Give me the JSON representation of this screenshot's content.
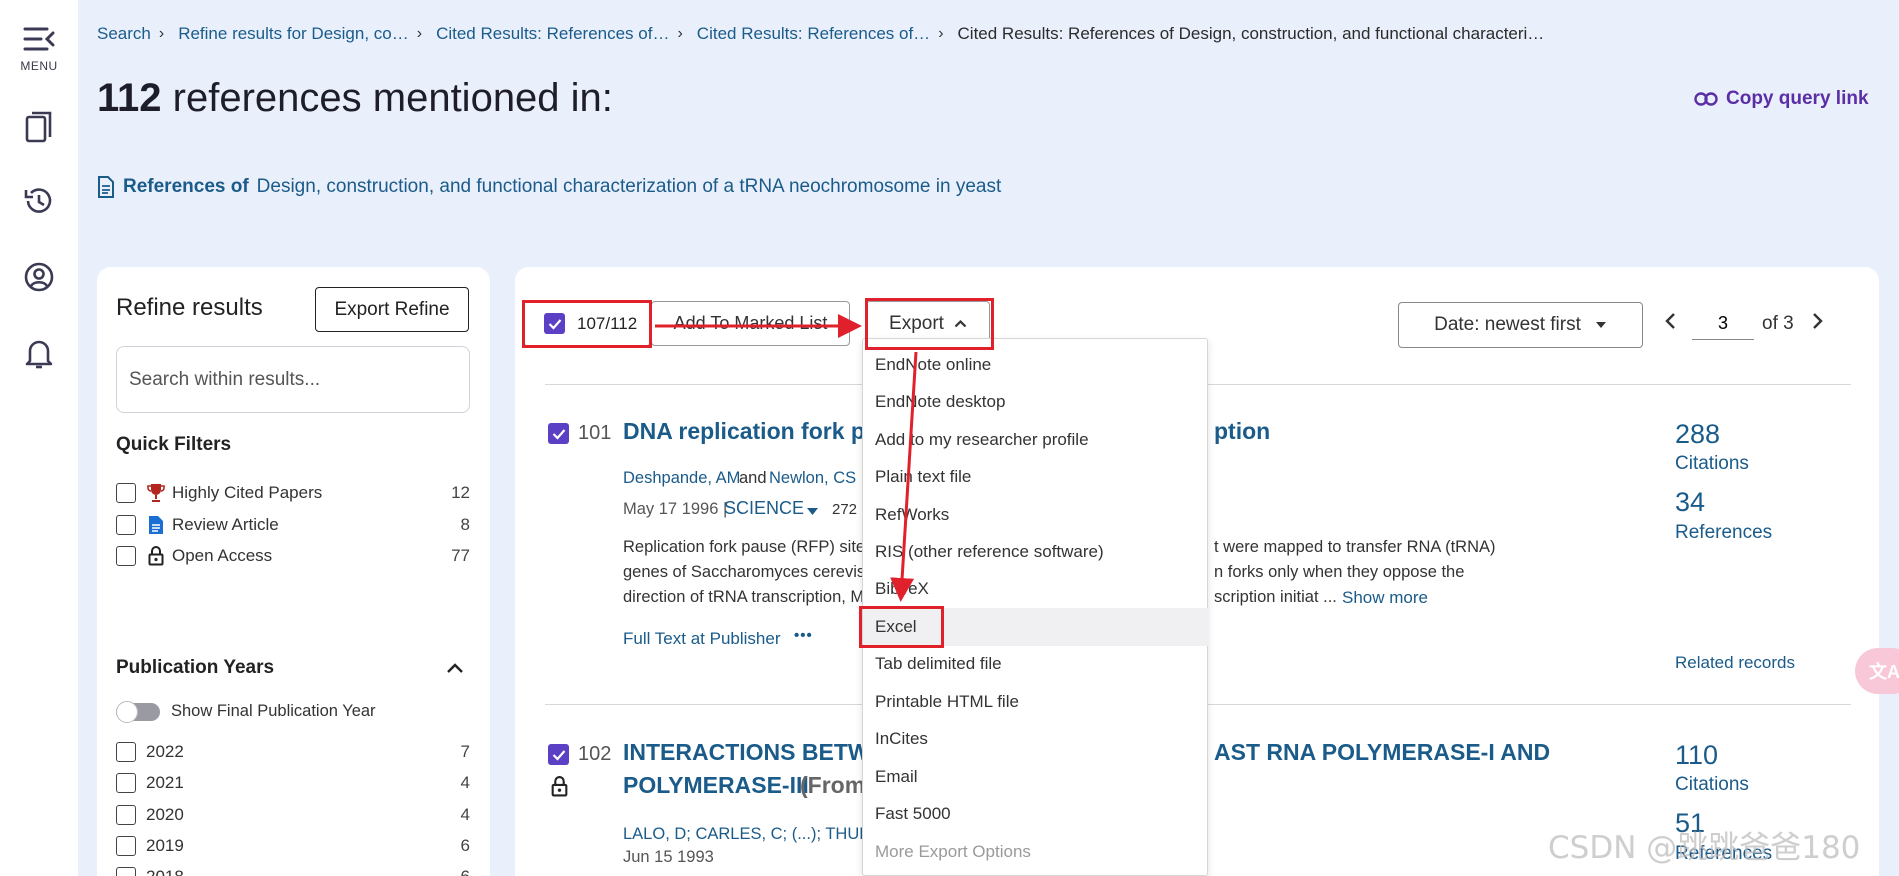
{
  "nav": {
    "menu_label": "MENU"
  },
  "breadcrumb": {
    "items": [
      "Search",
      "Refine results for Design, co…",
      "Cited Results: References of…",
      "Cited Results: References of…"
    ],
    "current": "Cited Results: References of Design, construction, and functional characteri…"
  },
  "header": {
    "count": "112",
    "title_rest": "references mentioned in:",
    "copy_link": "Copy query link",
    "refs_of_label": "References of",
    "refs_of_title": "Design, construction, and functional characterization of a tRNA neochromosome in yeast"
  },
  "refine": {
    "title": "Refine results",
    "export_button": "Export Refine",
    "search_placeholder": "Search within results...",
    "quick_filters_title": "Quick Filters",
    "quick_filters": [
      {
        "label": "Highly Cited Papers",
        "count": "12",
        "icon": "trophy-icon"
      },
      {
        "label": "Review Article",
        "count": "8",
        "icon": "document-icon"
      },
      {
        "label": "Open Access",
        "count": "77",
        "icon": "lock-open-icon"
      }
    ],
    "pub_years_title": "Publication Years",
    "toggle_label": "Show Final Publication Year",
    "years": [
      {
        "label": "2022",
        "count": "7"
      },
      {
        "label": "2021",
        "count": "4"
      },
      {
        "label": "2020",
        "count": "4"
      },
      {
        "label": "2019",
        "count": "6"
      },
      {
        "label": "2018",
        "count": "6"
      }
    ]
  },
  "toolbar": {
    "selected": "107/112",
    "add_marked": "Add To Marked List",
    "export": "Export",
    "sort": "Date: newest first",
    "page": "3",
    "of_pages": "of 3"
  },
  "export_menu": {
    "items": [
      "EndNote online",
      "EndNote desktop",
      "Add to my researcher profile",
      "Plain text file",
      "RefWorks",
      "RIS (other reference software)",
      "BibTeX",
      "Excel",
      "Tab delimited file",
      "Printable HTML file",
      "InCites",
      "Email",
      "Fast 5000",
      "More Export Options"
    ]
  },
  "records": [
    {
      "num": "101",
      "title_left": "DNA replication fork pa",
      "title_right": "ption",
      "authors_a": "Deshpande, AM",
      "authors_and": "and",
      "authors_b": "Newlon, CS",
      "date": "May 17 1996 |",
      "journal": "SCIENCE",
      "volume": "272 (",
      "abstract_l1": "Replication fork pause (RFP) sites",
      "abstract_r1": "t were mapped to transfer RNA (tRNA)",
      "abstract_l2": "genes of Saccharomyces cerevisia",
      "abstract_r2": "n forks only when they oppose the",
      "abstract_l3": "direction of tRNA transcription, M",
      "abstract_r3": "scription initiat ...",
      "show_more": "Show more",
      "full_text": "Full Text at Publisher",
      "more_dots": "•••",
      "citations": "288",
      "citations_label": "Citations",
      "references": "34",
      "references_label": "References",
      "related": "Related records"
    },
    {
      "num": "102",
      "title_l1": "INTERACTIONS BETWE",
      "title_r1": "AST RNA POLYMERASE-I AND",
      "title_l2": "POLYMERASE-III",
      "title_from": "(From",
      "authors": "LALO, D; CARLES, C; (...); THURIAU",
      "date": "Jun 15 1993",
      "citations": "110",
      "citations_label": "Citations",
      "references": "51",
      "references_label": "References"
    }
  ],
  "watermark": "CSDN @跳跳爸爸180",
  "translate_glyph": "文A",
  "colors": {
    "accent": "#5b3fc4",
    "link": "#1a5b8a",
    "highlight": "#e0202a"
  }
}
